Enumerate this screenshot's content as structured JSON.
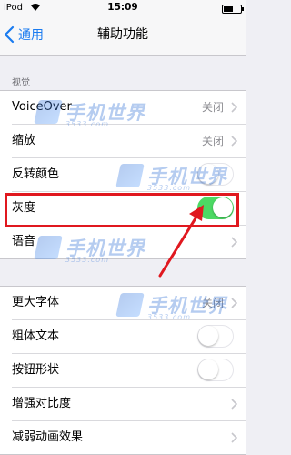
{
  "status_bar": {
    "carrier": "iPod",
    "time": "15:09"
  },
  "nav": {
    "back_label": "通用",
    "title": "辅助功能"
  },
  "section_header": "视觉",
  "group1": {
    "rows": [
      {
        "label": "VoiceOver",
        "value": "关闭"
      },
      {
        "label": "缩放",
        "value": "关闭"
      },
      {
        "label": "反转颜色",
        "toggle_on": false
      },
      {
        "label": "灰度",
        "toggle_on": true
      },
      {
        "label": "语音"
      }
    ]
  },
  "group2": {
    "rows": [
      {
        "label": "更大字体",
        "value": "关闭"
      },
      {
        "label": "粗体文本",
        "toggle_on": false
      },
      {
        "label": "按钮形状",
        "toggle_on": false
      },
      {
        "label": "增强对比度"
      },
      {
        "label": "减弱动画效果"
      }
    ]
  },
  "watermark": {
    "brand": "手机世界",
    "site": "3533.com"
  },
  "colors": {
    "accent": "#1a7bf0",
    "toggle_on": "#4cd964",
    "highlight": "#e0181f",
    "watermark": "#2f6fd6"
  }
}
